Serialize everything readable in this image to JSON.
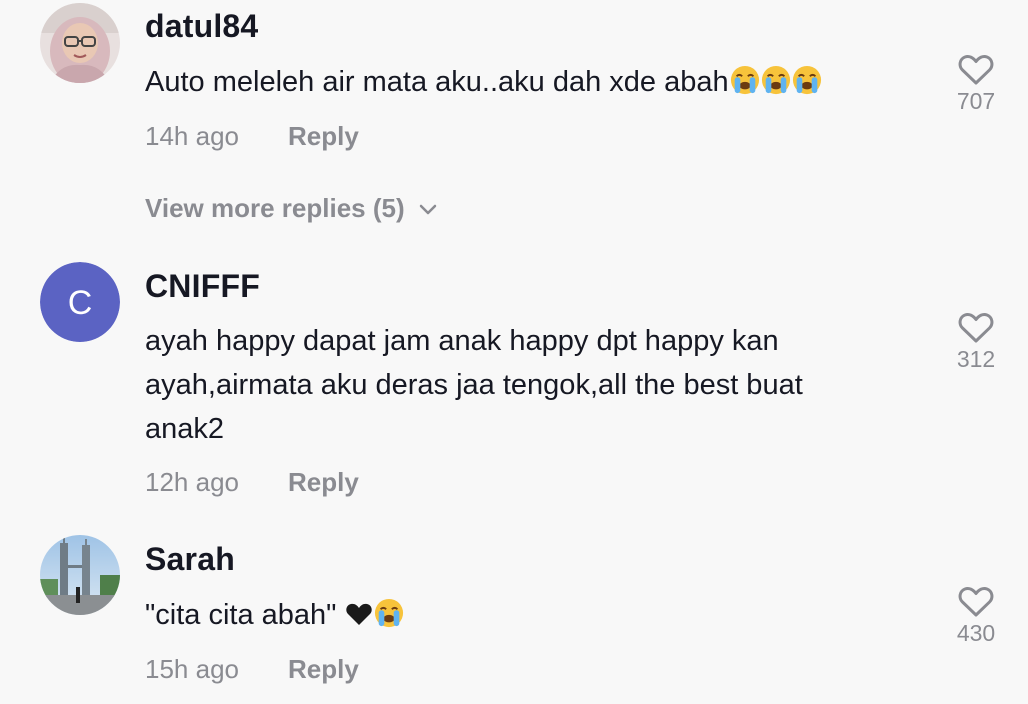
{
  "comments": [
    {
      "username": "datul84",
      "text": "Auto meleleh air mata aku..aku dah xde abah",
      "emojis": [
        "loudly-crying-face",
        "loudly-crying-face",
        "loudly-crying-face"
      ],
      "time": "14h ago",
      "reply_label": "Reply",
      "likes": "707",
      "view_more": "View more replies (5)"
    },
    {
      "username": "CNIFFF",
      "avatar_letter": "C",
      "avatar_color": "#5b63c3",
      "text": "ayah happy dapat jam anak happy dpt happy kan ayah,airmata aku deras jaa tengok,all the best buat anak2",
      "time": "12h ago",
      "reply_label": "Reply",
      "likes": "312"
    },
    {
      "username": "Sarah",
      "text": "\"cita cita abah\"",
      "emojis": [
        "black-heart",
        "loudly-crying-face"
      ],
      "time": "15h ago",
      "reply_label": "Reply",
      "likes": "430"
    }
  ],
  "colors": {
    "background": "#f8f8f8",
    "text_primary": "#161823",
    "text_secondary": "#8a8b91"
  }
}
